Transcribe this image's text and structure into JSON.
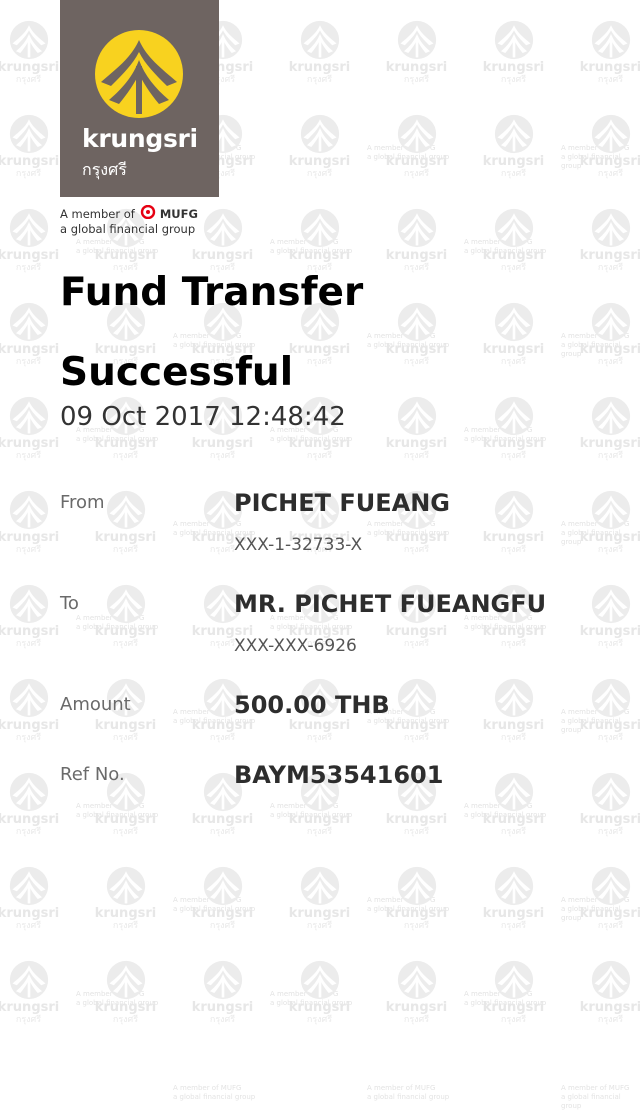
{
  "logo": {
    "brand": "krungsri",
    "brand_thai": "กรุงศรี",
    "member_prefix": "A member of",
    "mufg": "MUFG",
    "member_suffix": "a global financial group",
    "bg_color": "#6e6461",
    "emblem_color": "#f8d21f"
  },
  "watermark": {
    "brand": "krungsri",
    "brand_thai": "กรุงศรี",
    "member_line1": "A member of MUFG",
    "member_line2": "a global financial group"
  },
  "title": {
    "line1": "Fund Transfer",
    "line2": "Successful"
  },
  "datetime": "09 Oct 2017 12:48:42",
  "details": {
    "from_label": "From",
    "from_name": "PICHET FUEANG",
    "from_account": "XXX-1-32733-X",
    "to_label": "To",
    "to_name": "MR. PICHET FUEANGFU",
    "to_account": "XXX-XXX-6926",
    "amount_label": "Amount",
    "amount_value": "500.00 THB",
    "ref_label": "Ref No.",
    "ref_value": "BAYM53541601"
  }
}
